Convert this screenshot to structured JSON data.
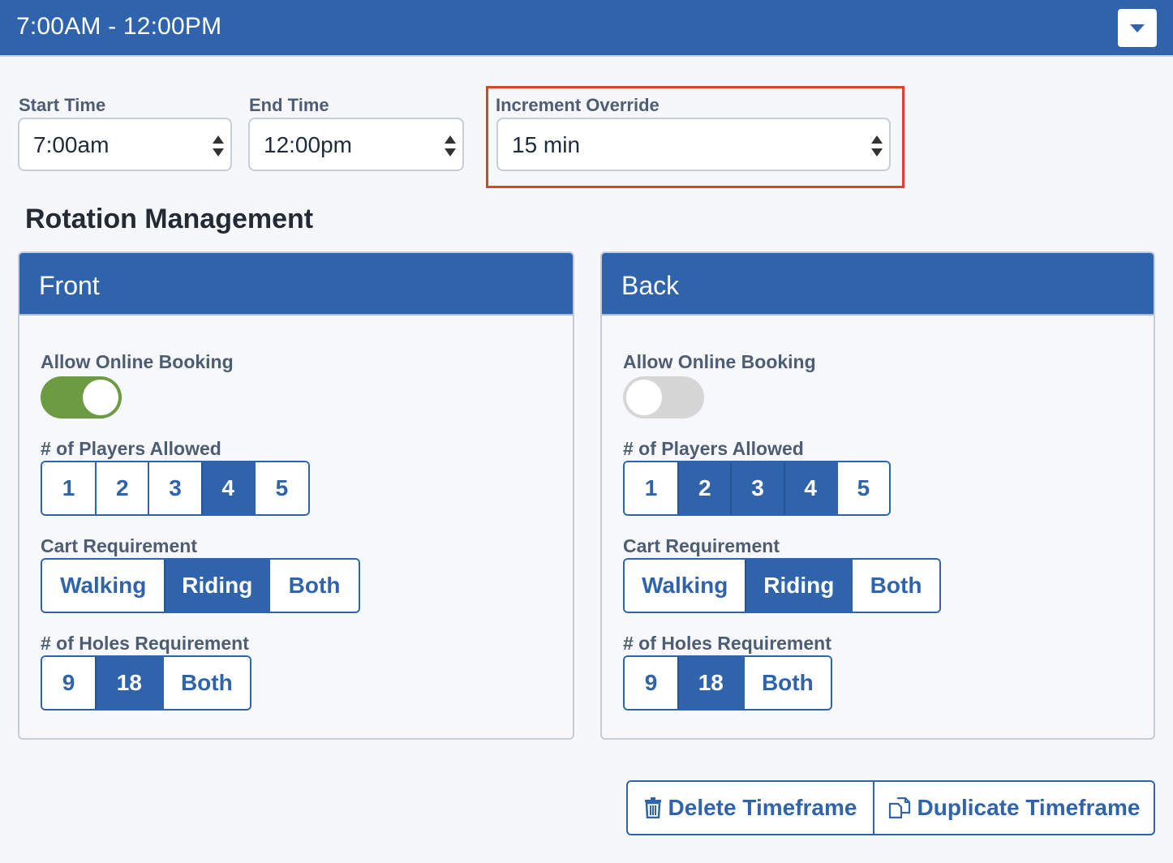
{
  "header": {
    "title": "7:00AM - 12:00PM",
    "toggle_icon": "caret-down-icon"
  },
  "timeframe": {
    "start_time": {
      "label": "Start Time",
      "value": "7:00am"
    },
    "end_time": {
      "label": "End Time",
      "value": "12:00pm"
    },
    "increment_override": {
      "label": "Increment Override",
      "value": "15 min",
      "highlight_color": "#e0402f"
    }
  },
  "rotation": {
    "title": "Rotation Management",
    "panels": [
      {
        "title": "Front",
        "online_booking": {
          "label": "Allow Online Booking",
          "enabled": true
        },
        "players": {
          "label": "# of Players Allowed",
          "options": [
            "1",
            "2",
            "3",
            "4",
            "5"
          ],
          "selected": [
            "4"
          ]
        },
        "cart": {
          "label": "Cart Requirement",
          "options": [
            "Walking",
            "Riding",
            "Both"
          ],
          "selected": [
            "Riding"
          ]
        },
        "holes": {
          "label": "# of Holes Requirement",
          "options": [
            "9",
            "18",
            "Both"
          ],
          "selected": [
            "18"
          ]
        }
      },
      {
        "title": "Back",
        "online_booking": {
          "label": "Allow Online Booking",
          "enabled": false
        },
        "players": {
          "label": "# of Players Allowed",
          "options": [
            "1",
            "2",
            "3",
            "4",
            "5"
          ],
          "selected": [
            "2",
            "3",
            "4"
          ]
        },
        "cart": {
          "label": "Cart Requirement",
          "options": [
            "Walking",
            "Riding",
            "Both"
          ],
          "selected": [
            "Riding"
          ]
        },
        "holes": {
          "label": "# of Holes Requirement",
          "options": [
            "9",
            "18",
            "Both"
          ],
          "selected": [
            "18"
          ]
        }
      }
    ]
  },
  "actions": {
    "delete_label": "Delete Timeframe",
    "delete_icon": "trash-icon",
    "duplicate_label": "Duplicate Timeframe",
    "duplicate_icon": "copy-icon"
  },
  "colors": {
    "primary": "#2f64ad",
    "toggle_on": "#6c9b43",
    "toggle_off": "#d6d6d6"
  }
}
